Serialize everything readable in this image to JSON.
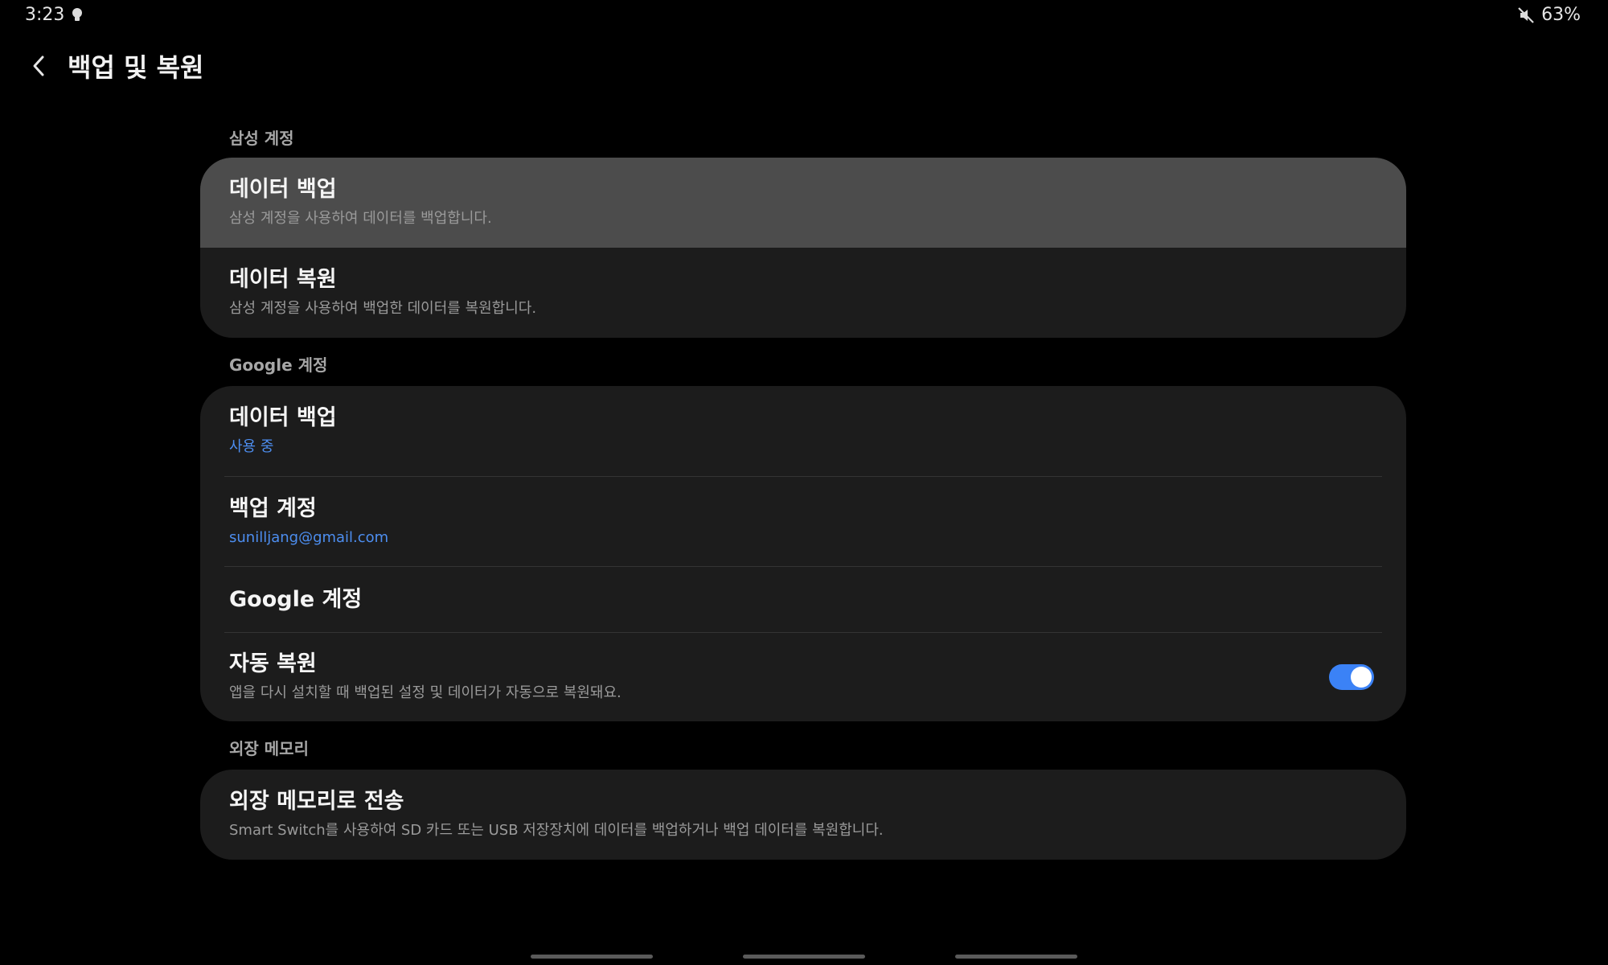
{
  "status_bar": {
    "time": "3:23",
    "battery": "63%"
  },
  "header": {
    "title": "백업 및 복원"
  },
  "sections": {
    "samsung": {
      "label": "삼성 계정",
      "items": [
        {
          "title": "데이터 백업",
          "subtitle": "삼성 계정을 사용하여 데이터를 백업합니다."
        },
        {
          "title": "데이터 복원",
          "subtitle": "삼성 계정을 사용하여 백업한 데이터를 복원합니다."
        }
      ]
    },
    "google": {
      "label": "Google 계정",
      "items": [
        {
          "title": "데이터 백업",
          "subtitle": "사용 중"
        },
        {
          "title": "백업 계정",
          "subtitle": "sunilljang@gmail.com"
        },
        {
          "title": "Google 계정"
        },
        {
          "title": "자동 복원",
          "subtitle": "앱을 다시 설치할 때 백업된 설정 및 데이터가 자동으로 복원돼요.",
          "toggle_on": true
        }
      ]
    },
    "external": {
      "label": "외장 메모리",
      "items": [
        {
          "title": "외장 메모리로 전송",
          "subtitle": "Smart Switch를 사용하여 SD 카드 또는 USB 저장장치에 데이터를 백업하거나 백업 데이터를 복원합니다."
        }
      ]
    }
  },
  "colors": {
    "background": "#000000",
    "card": "#1c1c1c",
    "highlight_row": "#4c4c4c",
    "accent_blue": "#4d8ef0",
    "toggle_on": "#3b82f6"
  },
  "icons": {
    "back": "chevron-left-icon",
    "status_light": "lightbulb-icon",
    "mute": "mute-icon"
  }
}
